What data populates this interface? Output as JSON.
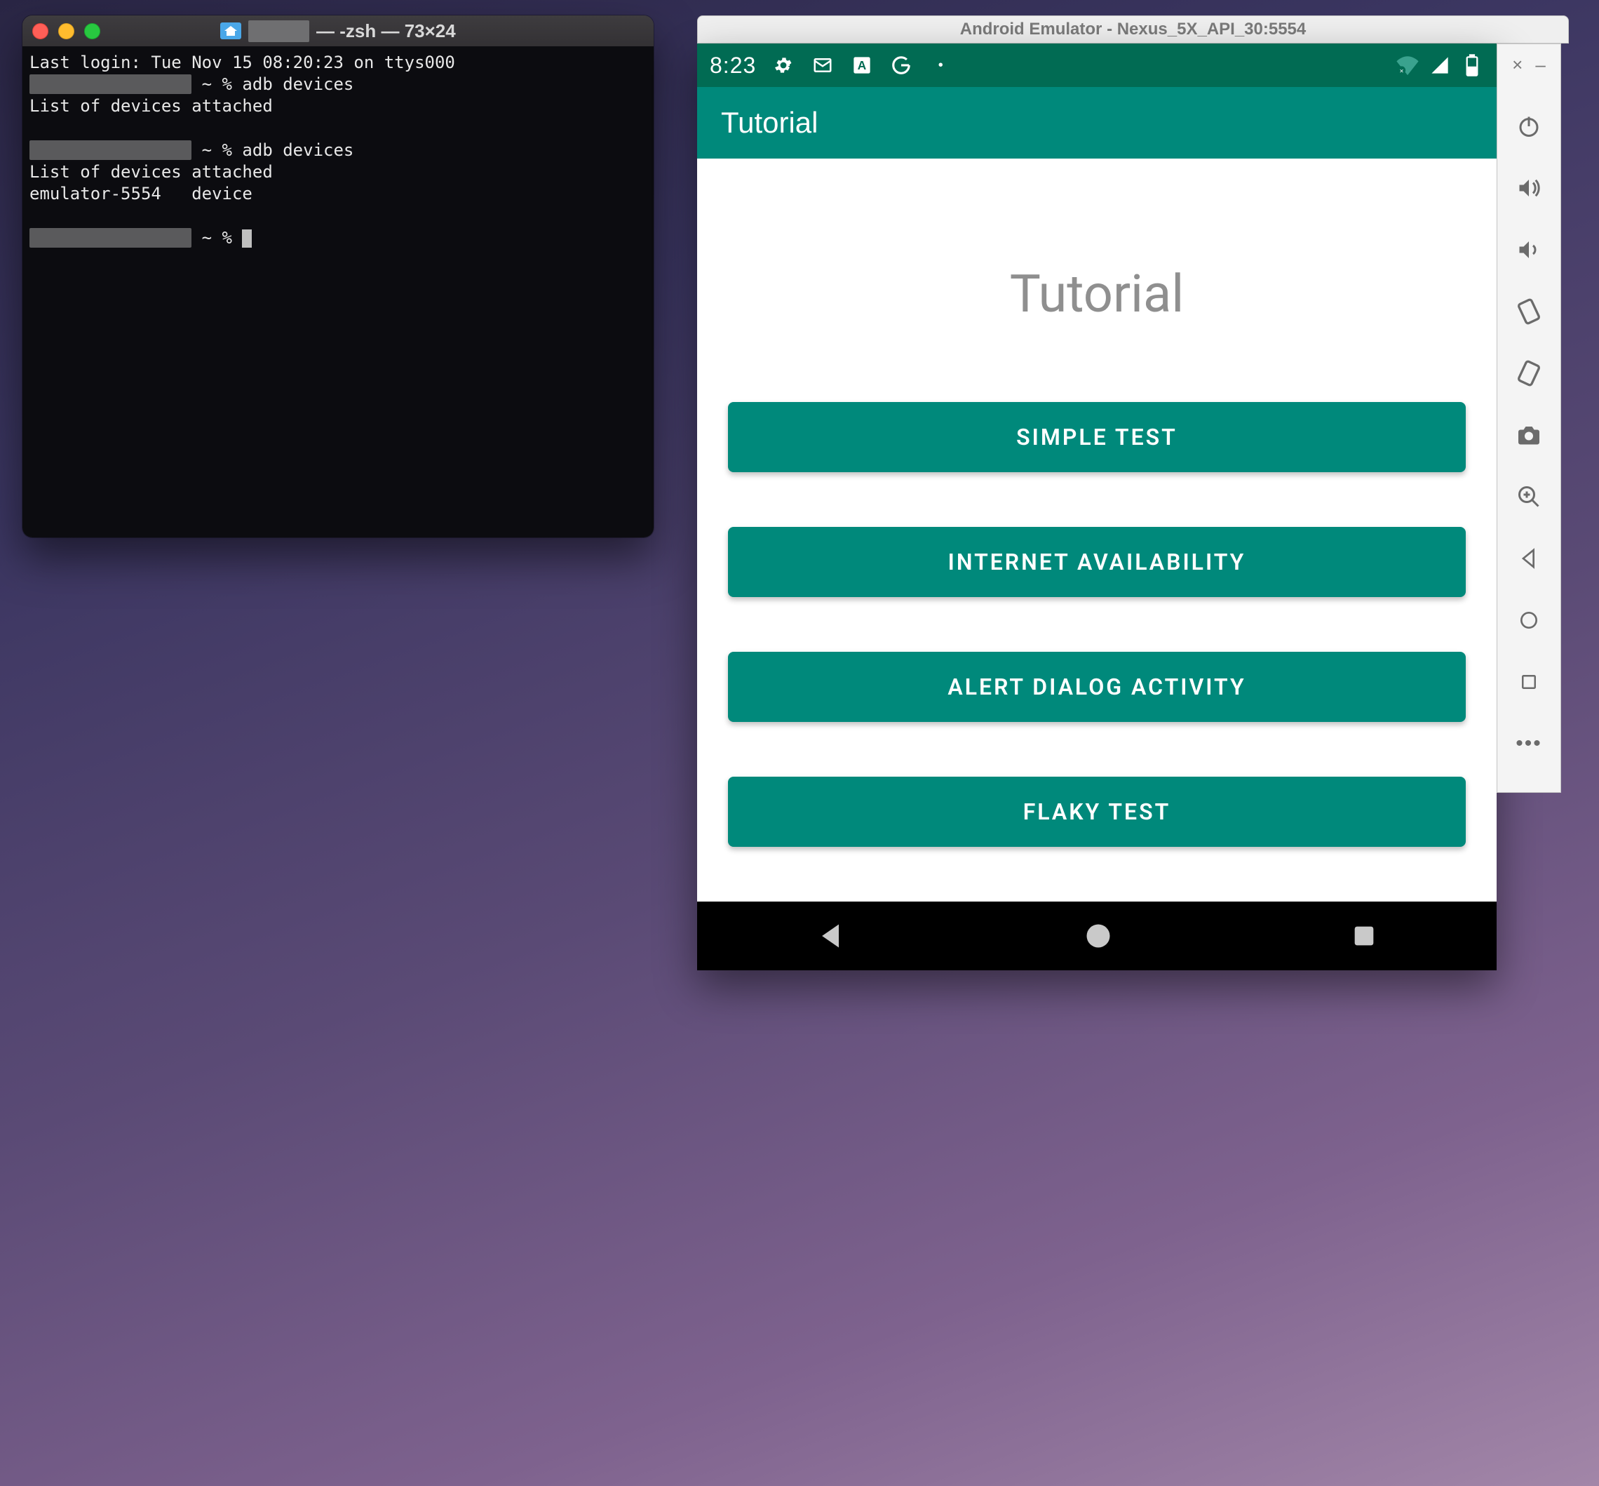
{
  "terminal": {
    "title_suffix": " — -zsh — 73×24",
    "lines": {
      "l1": "Last login: Tue Nov 15 08:20:23 on ttys000",
      "l2_prompt": " ~ % adb devices",
      "l3": "List of devices attached",
      "l4": "",
      "l5_prompt": " ~ % adb devices",
      "l6": "List of devices attached",
      "l7": "emulator-5554   device",
      "l8": "",
      "l9_prompt": " ~ % "
    }
  },
  "emulator": {
    "title": "Android Emulator - Nexus_5X_API_30:5554",
    "statusbar": {
      "time": "8:23"
    },
    "appbar": {
      "title": "Tutorial"
    },
    "heading": "Tutorial",
    "buttons": [
      "SIMPLE TEST",
      "INTERNET AVAILABILITY",
      "ALERT DIALOG ACTIVITY",
      "FLAKY TEST"
    ],
    "sidebar": {
      "close_glyph": "×",
      "minimize_glyph": "–"
    }
  }
}
